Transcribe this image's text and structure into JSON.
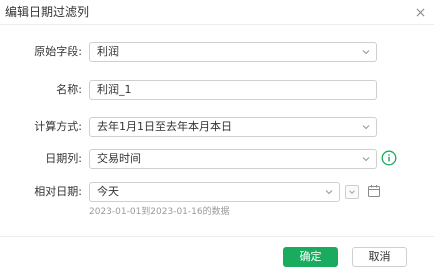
{
  "dialog": {
    "title": "编辑日期过滤列",
    "close_icon": "close-icon"
  },
  "form": {
    "source_field": {
      "label": "原始字段:",
      "value": "利润"
    },
    "name": {
      "label": "名称:",
      "value": "利润_1"
    },
    "calc_method": {
      "label": "计算方式:",
      "value": "去年1月1日至去年本月本日"
    },
    "date_column": {
      "label": "日期列:",
      "value": "交易时间",
      "info_icon": "info-icon"
    },
    "relative_date": {
      "label": "相对日期:",
      "value": "今天",
      "calendar_icon": "calendar-icon"
    },
    "hint": "2023-01-01到2023-01-16的数据"
  },
  "footer": {
    "ok_label": "确定",
    "cancel_label": "取消"
  },
  "colors": {
    "accent": "#1aab5f",
    "border": "#cfcfcf",
    "hint_text": "#9a9a9a"
  }
}
